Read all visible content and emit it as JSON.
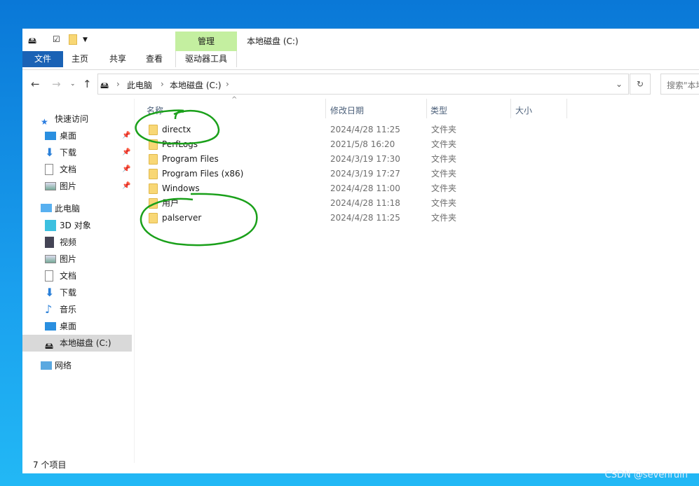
{
  "ribbon": {
    "context_group": "管理",
    "title": "本地磁盘 (C:)",
    "tabs": [
      "文件",
      "主页",
      "共享",
      "查看",
      "驱动器工具"
    ]
  },
  "address": {
    "crumbs": [
      "此电脑",
      "本地磁盘 (C:)"
    ],
    "search_placeholder": "搜索\"本地磁盘 (C:)\""
  },
  "sidebar": {
    "quick_access": "快速访问",
    "quick": [
      "桌面",
      "下载",
      "文档",
      "图片"
    ],
    "this_pc": "此电脑",
    "pc": [
      "3D 对象",
      "视频",
      "图片",
      "文档",
      "下载",
      "音乐",
      "桌面",
      "本地磁盘 (C:)"
    ],
    "network": "网络"
  },
  "columns": [
    "名称",
    "修改日期",
    "类型",
    "大小"
  ],
  "files": [
    {
      "name": "directx",
      "date": "2024/4/28 11:25",
      "type": "文件夹"
    },
    {
      "name": "PerfLogs",
      "date": "2021/5/8 16:20",
      "type": "文件夹"
    },
    {
      "name": "Program Files",
      "date": "2024/3/19 17:30",
      "type": "文件夹"
    },
    {
      "name": "Program Files (x86)",
      "date": "2024/3/19 17:27",
      "type": "文件夹"
    },
    {
      "name": "Windows",
      "date": "2024/4/28 11:00",
      "type": "文件夹"
    },
    {
      "name": "用户",
      "date": "2024/4/28 11:18",
      "type": "文件夹"
    },
    {
      "name": "palserver",
      "date": "2024/4/28 11:25",
      "type": "文件夹"
    }
  ],
  "status": "7 个项目",
  "watermark": "CSDN @sevenruin"
}
